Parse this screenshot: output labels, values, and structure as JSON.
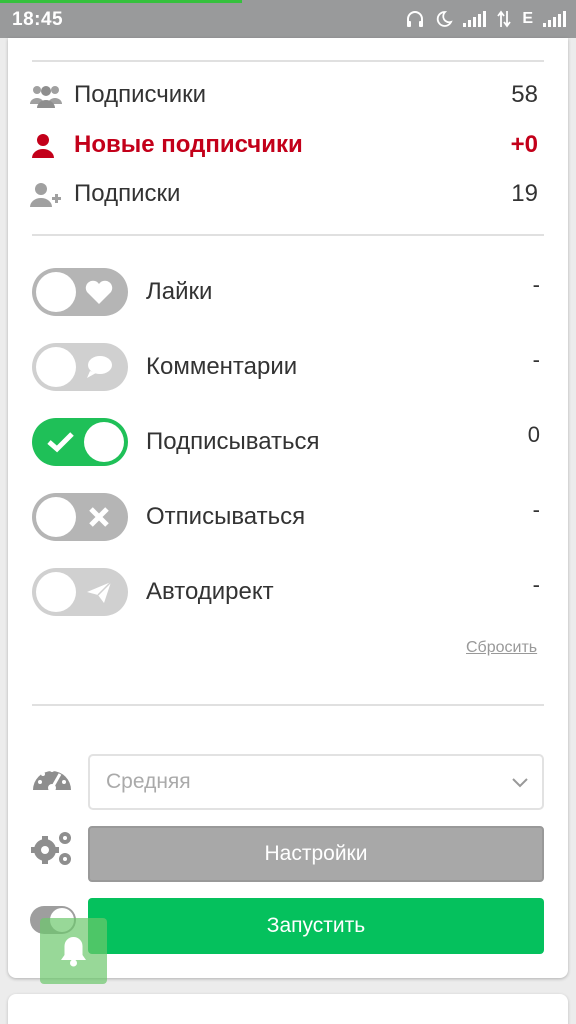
{
  "status_bar": {
    "time": "18:45",
    "network_label": "E",
    "icons": [
      "headphones-icon",
      "moon-icon",
      "signal-icon",
      "data-arrows-icon",
      "signal-icon"
    ]
  },
  "stats": {
    "followers": {
      "label": "Подписчики",
      "value": "58",
      "icon": "group-icon"
    },
    "new_followers": {
      "label": "Новые подписчики",
      "value": "+0",
      "icon": "user-icon",
      "color": "#c3001a"
    },
    "following": {
      "label": "Подписки",
      "value": "19",
      "icon": "user-add-icon"
    }
  },
  "actions": [
    {
      "label": "Лайки",
      "value": "-",
      "enabled": false,
      "icon": "heart-icon"
    },
    {
      "label": "Комментарии",
      "value": "-",
      "enabled": false,
      "icon": "comment-icon"
    },
    {
      "label": "Подписываться",
      "value": "0",
      "enabled": true,
      "icon": "check-icon"
    },
    {
      "label": "Отписываться",
      "value": "-",
      "enabled": false,
      "icon": "x-icon"
    },
    {
      "label": "Автодирект",
      "value": "-",
      "enabled": false,
      "icon": "paper-plane-icon"
    }
  ],
  "reset_label": "Сбросить",
  "speed": {
    "selected": "Средняя",
    "icon": "speedometer-icon"
  },
  "settings_button": "Настройки",
  "start_button": "Запустить",
  "colors": {
    "accent_green": "#05c15d",
    "toggle_on": "#1fc058",
    "alert_red": "#c3001a",
    "toggle_off": "#b5b5b5"
  }
}
